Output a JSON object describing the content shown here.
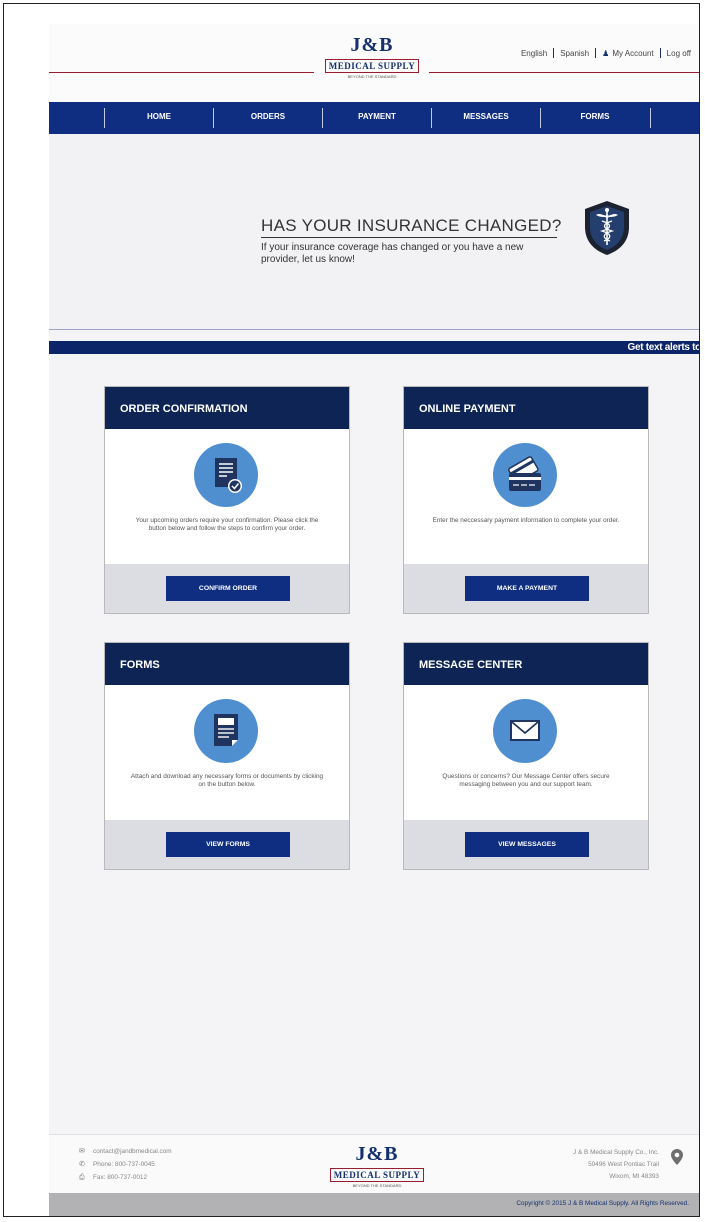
{
  "header": {
    "logo": {
      "top": "J&B",
      "band": "MEDICAL SUPPLY",
      "tagline": "BEYOND THE STANDARD"
    },
    "links": {
      "english": "English",
      "spanish": "Spanish",
      "my_account": "My Account",
      "logoff": "Log off"
    }
  },
  "nav": {
    "items": [
      "HOME",
      "ORDERS",
      "PAYMENT",
      "MESSAGES",
      "FORMS"
    ]
  },
  "hero": {
    "title": "HAS YOUR INSURANCE CHANGED?",
    "text": "If your insurance coverage has changed or you have a new provider, let us know!",
    "icon": "caduceus-shield-icon"
  },
  "ticker": {
    "text": "Get text alerts to"
  },
  "cards": [
    {
      "title": "ORDER CONFIRMATION",
      "icon": "document-check-icon",
      "text": "Your upcoming orders require your confirmation. Please click the button below and follow the steps to confirm your order.",
      "button": "CONFIRM ORDER"
    },
    {
      "title": "ONLINE PAYMENT",
      "icon": "credit-card-icon",
      "text": "Enter the neccessary payment information to complete your order.",
      "button": "MAKE A PAYMENT"
    },
    {
      "title": "FORMS",
      "icon": "form-document-icon",
      "text": "Attach and download any necessary forms or documents by clicking on the button below.",
      "button": "VIEW FORMS"
    },
    {
      "title": "MESSAGE CENTER",
      "icon": "envelope-icon",
      "text": "Questions or concerns? Our Message Center offers secure messaging between you and our support team.",
      "button": "VIEW MESSAGES"
    }
  ],
  "footer": {
    "email": "contact@jandbmedical.com",
    "phone": "Phone: 800-737-0045",
    "fax": "Fax: 800-737-0012",
    "company": "J & B Medical Supply Co., Inc.",
    "street": "50496 West Pontiac Trail",
    "city": "Wixom, MI 48393",
    "copyright": "Copyright © 2015 J & B Medical Supply. All Rights Reserved."
  },
  "colors": {
    "navy": "#0f2e82",
    "card_header": "#0e2454",
    "icon_circle": "#4f8fcf",
    "accent_red": "#9b1b30"
  }
}
